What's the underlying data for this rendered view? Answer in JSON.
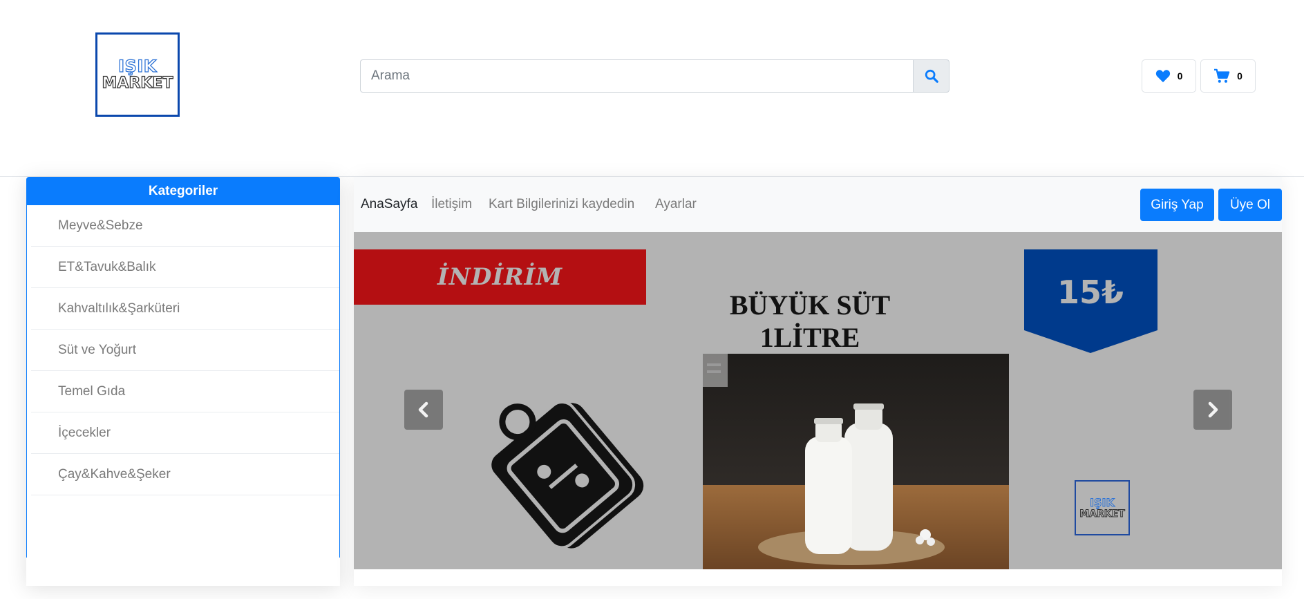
{
  "brand": {
    "logo_line1": "IŞIK",
    "logo_line2": "MARKET"
  },
  "search": {
    "placeholder": "Arama",
    "value": ""
  },
  "favorites": {
    "count": "0",
    "icon": "heart-icon"
  },
  "cart": {
    "count": "0",
    "icon": "shopping-cart-icon"
  },
  "sidebar": {
    "title": "Kategoriler",
    "items": [
      {
        "label": "Meyve&Sebze"
      },
      {
        "label": "ET&Tavuk&Balık"
      },
      {
        "label": "Kahvaltılık&Şarküteri"
      },
      {
        "label": "Süt ve Yoğurt"
      },
      {
        "label": "Temel Gıda"
      },
      {
        "label": "İçecekler"
      },
      {
        "label": "Çay&Kahve&Şeker"
      }
    ]
  },
  "nav": {
    "links": [
      {
        "label": "AnaSayfa"
      },
      {
        "label": "İletişim"
      },
      {
        "label": "Kart Bilgilerinizi kaydedin"
      },
      {
        "label": "Ayarlar"
      }
    ],
    "login_label": "Giriş Yap",
    "signup_label": "Üye Ol"
  },
  "banner": {
    "discount_label": "İNDİRİM",
    "product_line1": "BÜYÜK SÜT",
    "product_line2": "1LİTRE",
    "price": "15₺",
    "logo_line1": "IŞIK",
    "logo_line2": "MARKET"
  },
  "colors": {
    "primary": "#0a7cfd",
    "logo_blue": "#0b48ad",
    "banner_red": "#b40f12",
    "price_blue": "#003a8c"
  }
}
